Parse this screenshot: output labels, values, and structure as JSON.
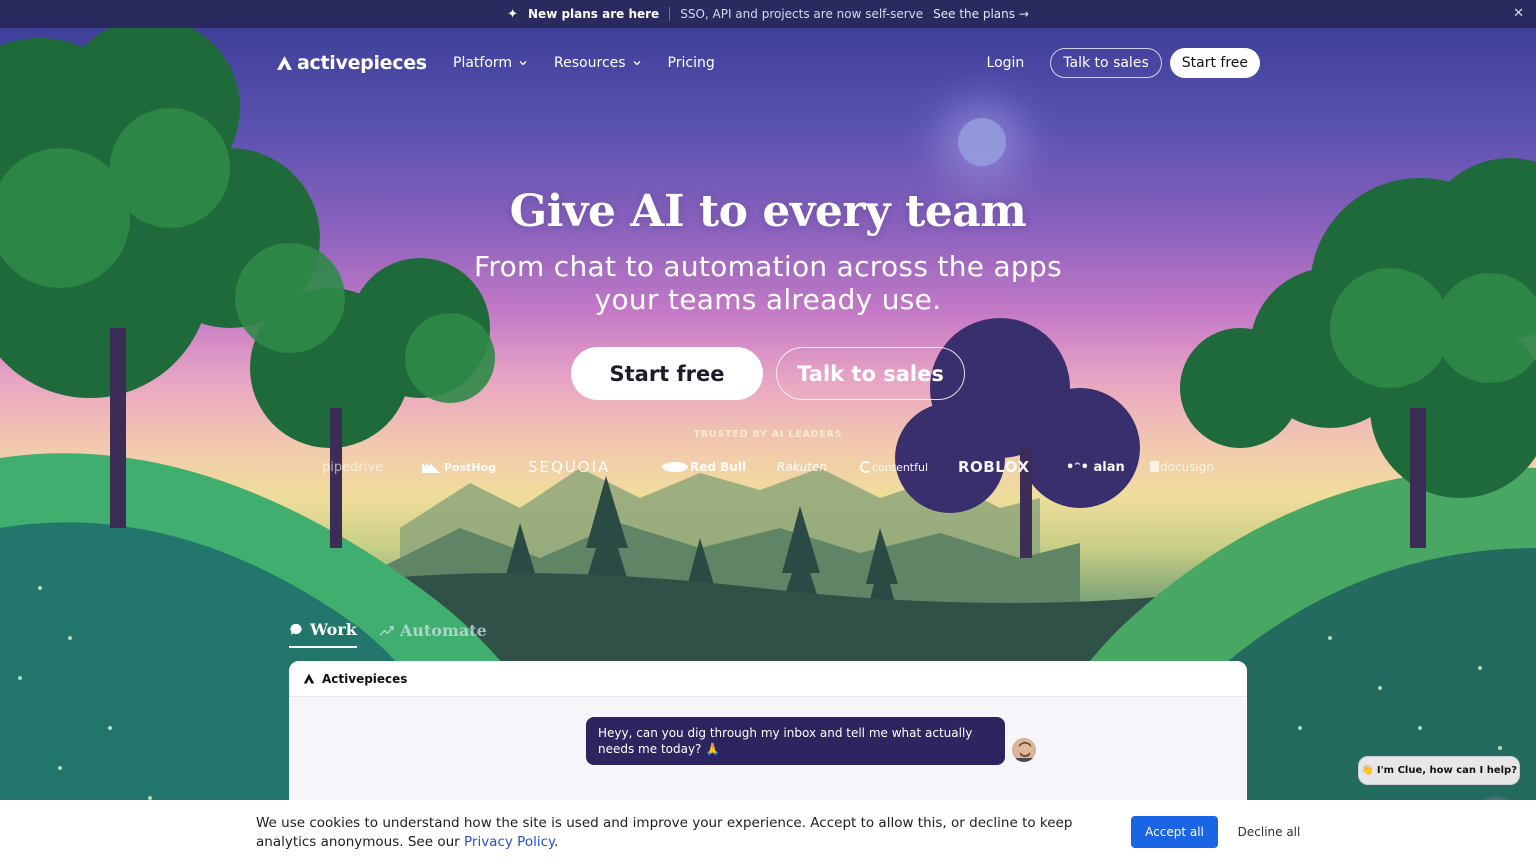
{
  "announcement": {
    "headline": "New plans are here",
    "text": "SSO, API and projects are now self-serve",
    "link": "See the plans →"
  },
  "nav": {
    "logo": "activepieces",
    "links": [
      "Platform",
      "Resources",
      "Pricing"
    ],
    "login": "Login",
    "talk_to_sales": "Talk to sales",
    "start_free": "Start free"
  },
  "hero": {
    "title": "Give AI to every team",
    "subtitle": "From chat to automation across the apps your teams already use.",
    "cta_primary": "Start free",
    "cta_secondary": "Talk to sales"
  },
  "trusted": {
    "label": "TRUSTED BY AI LEADERS",
    "brands": [
      "pipedrive",
      "PostHog",
      "SEQUOIA",
      "Red Bull",
      "Rakuten",
      "contentful",
      "ROBLOX",
      "alan",
      "docusign"
    ]
  },
  "tabs": [
    "Work",
    "Automate"
  ],
  "card": {
    "app_name": "Activepieces",
    "message": "Heyy, can you dig through my inbox and tell me what actually needs me today? 🙏"
  },
  "clue": {
    "text": "👋 I'm Clue, how can I help?"
  },
  "cookie": {
    "text": "We use cookies to understand how the site is used and improve your experience. Accept to allow this, or decline to keep analytics anonymous. See our",
    "link": "Privacy Policy",
    "accept": "Accept all",
    "decline": "Decline all"
  },
  "colors": {
    "accent": "#1a64e6",
    "bubble": "#2d2560",
    "announcement_bg": "#2a2a5e"
  }
}
